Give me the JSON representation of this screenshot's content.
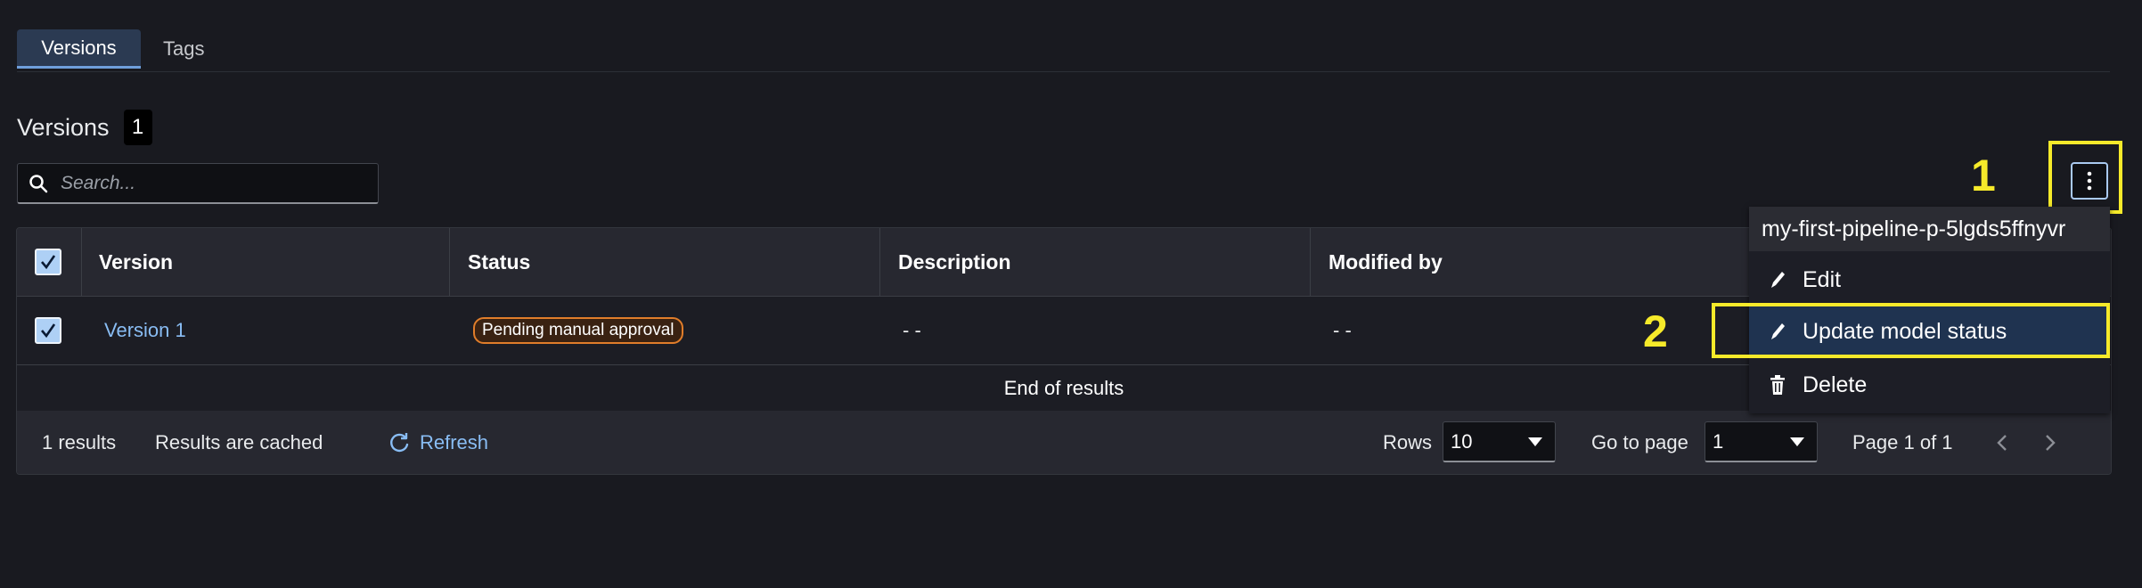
{
  "tabs": [
    {
      "label": "Versions",
      "active": true
    },
    {
      "label": "Tags",
      "active": false
    }
  ],
  "heading": {
    "title": "Versions",
    "count": "1"
  },
  "search": {
    "placeholder": "Search..."
  },
  "table": {
    "columns": [
      "Version",
      "Status",
      "Description",
      "Modified by"
    ],
    "rows": [
      {
        "version": "Version 1",
        "status": "Pending manual approval",
        "description": "- -",
        "modified_by": "- -"
      }
    ],
    "end_text": "End of results"
  },
  "footer": {
    "results": "1 results",
    "cached": "Results are cached",
    "refresh": "Refresh",
    "rows_label": "Rows",
    "rows_value": "10",
    "goto_label": "Go to page",
    "goto_value": "1",
    "page_text": "Page 1 of 1"
  },
  "menu": {
    "header": "my-first-pipeline-p-5lgds5ffnyvr",
    "items": [
      {
        "label": "Edit",
        "icon": "pencil-icon"
      },
      {
        "label": "Update model status",
        "icon": "pencil-icon"
      },
      {
        "label": "Delete",
        "icon": "trash-icon"
      }
    ]
  },
  "annotations": {
    "one": "1",
    "two": "2"
  },
  "colors": {
    "annotation": "#f6ea2a",
    "accent": "#89bdf4",
    "badge_border": "#e07d2a"
  }
}
